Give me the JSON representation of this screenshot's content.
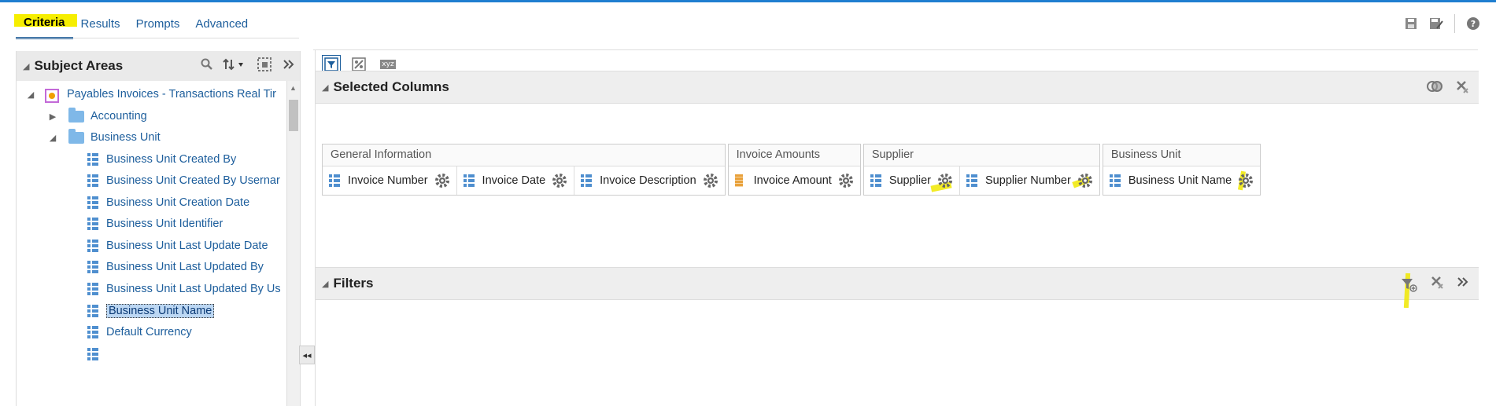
{
  "tabs": [
    "Criteria",
    "Results",
    "Prompts",
    "Advanced"
  ],
  "subject_areas": {
    "title": "Subject Areas",
    "root": "Payables Invoices - Transactions Real Tir",
    "folders": [
      "Accounting",
      "Business Unit"
    ],
    "columns": [
      "Business Unit Created By",
      "Business Unit Created By Usernar",
      "Business Unit Creation Date",
      "Business Unit Identifier",
      "Business Unit Last Update Date",
      "Business Unit Last Updated By",
      "Business Unit Last Updated By Us",
      "Business Unit Name",
      "Default Currency"
    ],
    "selected": "Business Unit Name"
  },
  "toolbar": {
    "xyz_label": "xyz"
  },
  "selected_columns": {
    "title": "Selected Columns",
    "groups": [
      {
        "name": "General Information",
        "columns": [
          "Invoice Number",
          "Invoice Date",
          "Invoice Description"
        ]
      },
      {
        "name": "Invoice Amounts",
        "columns": [
          "Invoice Amount"
        ]
      },
      {
        "name": "Supplier",
        "columns": [
          "Supplier",
          "Supplier Number"
        ]
      },
      {
        "name": "Business Unit",
        "columns": [
          "Business Unit Name"
        ]
      }
    ]
  },
  "filters": {
    "title": "Filters"
  },
  "colors": {
    "link": "#1d5e9c",
    "highlight": "#f6ee00",
    "accent": "#1f7ed0"
  }
}
